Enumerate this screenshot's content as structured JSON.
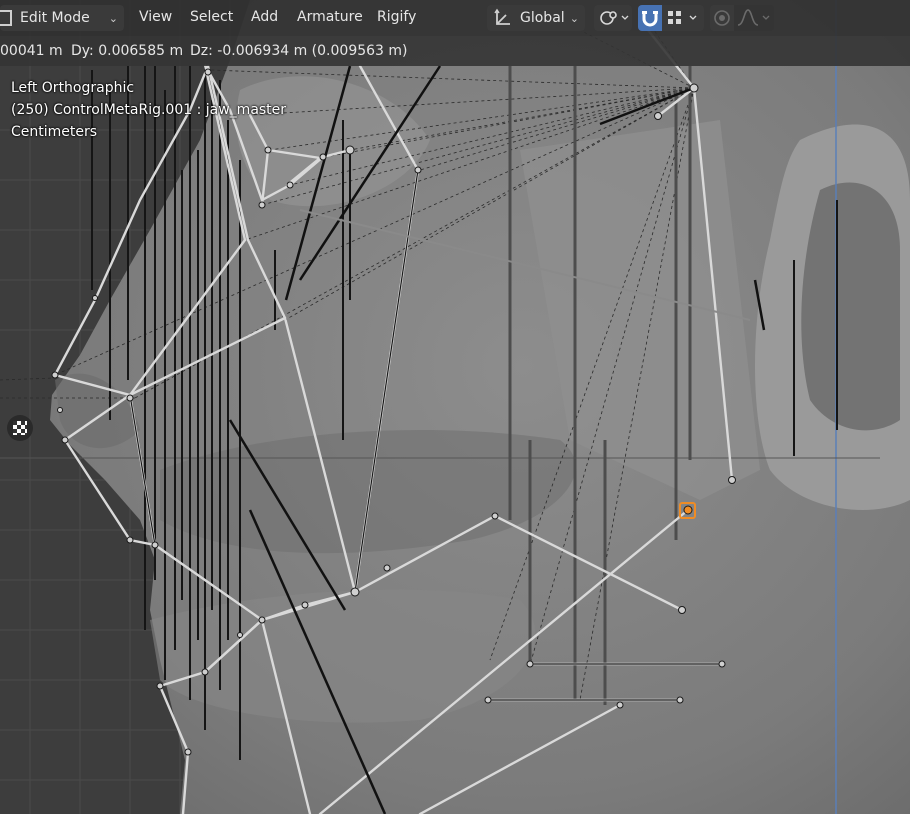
{
  "header": {
    "mode": "Edit Mode",
    "menus": [
      "View",
      "Select",
      "Add",
      "Armature",
      "Rigify"
    ],
    "orientation": "Global",
    "icons": {
      "mode": "armature-edit-icon",
      "orientation": "transform-orientation-icon",
      "pivot": "pivot-point-icon",
      "snap": "snap-magnet-icon",
      "snap_target": "snap-increment-icon",
      "proportional": "proportional-editing-icon",
      "falloff": "falloff-curve-icon"
    }
  },
  "status": {
    "dx": "00041 m",
    "dy": "Dy: 0.006585 m",
    "dz": "Dz: -0.006934 m (0.009563 m)"
  },
  "overlay": {
    "view_name": "Left Orthographic",
    "object_info": "(250) ControlMetaRig.001 : jaw_master",
    "units": "Centimeters"
  },
  "sidebar": {
    "icon": "checker-texture-icon"
  },
  "colors": {
    "accent": "#4772b3",
    "selection": "#f08c24",
    "background": "#3d3d3d"
  }
}
